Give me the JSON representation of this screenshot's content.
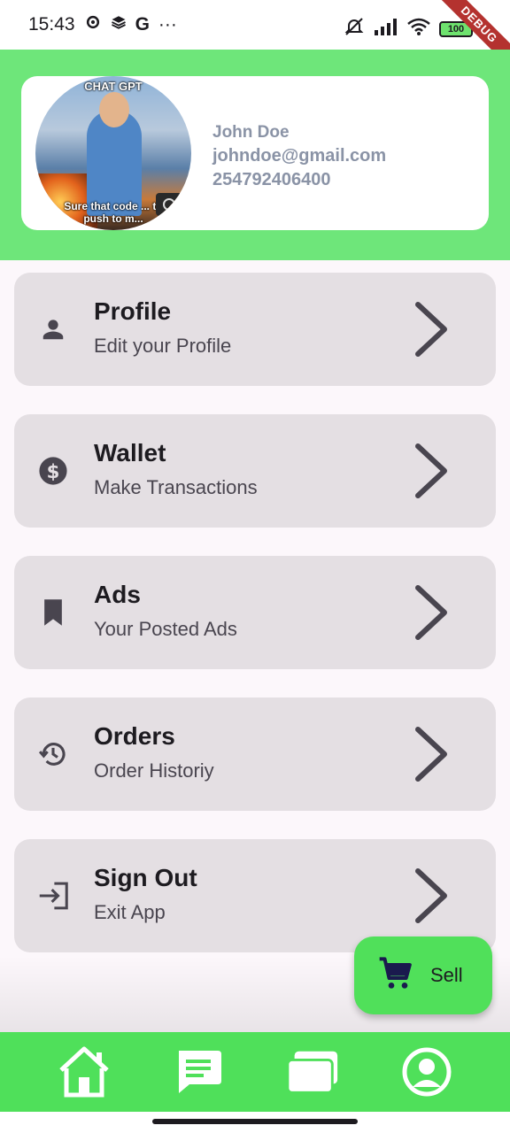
{
  "status_bar": {
    "time": "15:43",
    "google_letter": "G",
    "more": "···",
    "battery": "100",
    "debug_label": "DEBUG"
  },
  "profile": {
    "avatar_caption_top": "CHAT GPT",
    "avatar_caption_bottom": "Sure that code ... to push to m...",
    "name": "John Doe",
    "email": "johndoe@gmail.com",
    "phone": "254792406400"
  },
  "menu": [
    {
      "title": "Profile",
      "subtitle": "Edit your Profile",
      "icon": "person-icon"
    },
    {
      "title": "Wallet",
      "subtitle": "Make Transactions",
      "icon": "dollar-circle-icon"
    },
    {
      "title": "Ads",
      "subtitle": "Your Posted Ads",
      "icon": "bookmark-icon"
    },
    {
      "title": "Orders",
      "subtitle": "Order Historiy",
      "icon": "history-icon"
    },
    {
      "title": "Sign Out",
      "subtitle": "Exit App",
      "icon": "login-arrow-icon"
    }
  ],
  "fab": {
    "label": "Sell",
    "icon": "cart-icon"
  },
  "bottom_nav": [
    {
      "icon": "home-icon"
    },
    {
      "icon": "chat-icon"
    },
    {
      "icon": "cards-icon"
    },
    {
      "icon": "account-circle-icon"
    }
  ],
  "colors": {
    "header_green": "#6ee67a",
    "nav_green": "#4fe05a",
    "card_grey": "#e4dfe3",
    "fab_green": "#50e05a"
  }
}
